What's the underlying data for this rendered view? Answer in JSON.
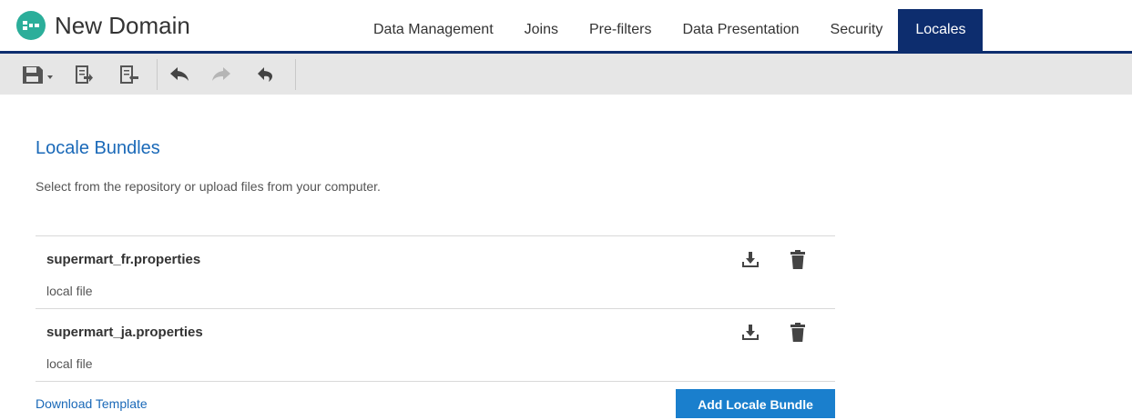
{
  "app": {
    "title": "New Domain"
  },
  "tabs": [
    {
      "label": "Data Management"
    },
    {
      "label": "Joins"
    },
    {
      "label": "Pre-filters"
    },
    {
      "label": "Data Presentation"
    },
    {
      "label": "Security"
    },
    {
      "label": "Locales",
      "active": true
    }
  ],
  "toolbar": {
    "icons": [
      "save-icon",
      "export-icon",
      "import-icon",
      "undo-icon",
      "redo-icon",
      "undo-all-icon"
    ]
  },
  "main": {
    "title": "Locale Bundles",
    "description": "Select from the repository or upload files from your computer.",
    "bundles": [
      {
        "name": "supermart_fr.properties",
        "source": "local file"
      },
      {
        "name": "supermart_ja.properties",
        "source": "local file"
      }
    ],
    "download_template": "Download Template",
    "add_button": "Add Locale Bundle"
  },
  "colors": {
    "accent": "#0d2d6e",
    "link": "#1a69b8",
    "button": "#1a7fcd",
    "toolbar_bg": "#e6e6e6"
  }
}
